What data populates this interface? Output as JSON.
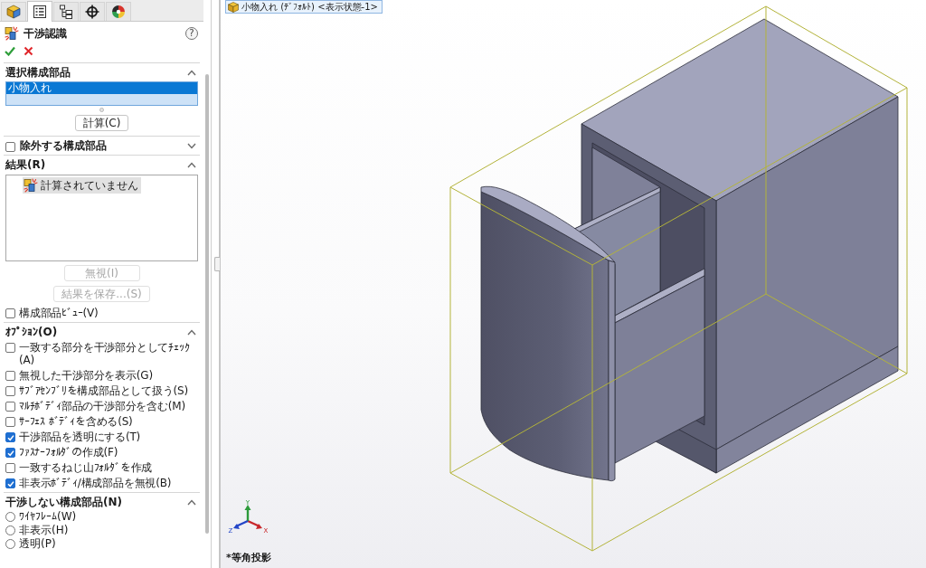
{
  "panel_tabs": [
    {
      "kind": "feature_tree",
      "selected": false
    },
    {
      "kind": "property_manager",
      "selected": true
    },
    {
      "kind": "configuration",
      "selected": false
    },
    {
      "kind": "dimxpert",
      "selected": false
    },
    {
      "kind": "display",
      "selected": false
    }
  ],
  "title": "干渉認識",
  "help": "?",
  "selected_components": {
    "heading": "選択構成部品",
    "expanded": true,
    "items": [
      {
        "label": "小物入れ",
        "selected": true
      }
    ],
    "calculate_button": "計算(C)"
  },
  "excluded_components": {
    "heading": "除外する構成部品",
    "checked": false,
    "expanded": false
  },
  "results": {
    "heading": "結果(R)",
    "expanded": true,
    "items": [
      {
        "label": "計算されていません",
        "selected": true
      }
    ],
    "buttons": [
      {
        "label": "無視(I)",
        "disabled": true
      },
      {
        "label": "結果を保存...(S)",
        "disabled": true
      }
    ],
    "component_view": {
      "label": "構成部品ﾋﾞｭｰ(V)",
      "checked": false
    }
  },
  "options": {
    "heading": "ｵﾌﾟｼｮﾝ(O)",
    "expanded": true,
    "items": [
      {
        "label": "一致する部分を干渉部分としてﾁｪｯｸ(A)",
        "checked": false
      },
      {
        "label": "無視した干渉部分を表示(G)",
        "checked": false
      },
      {
        "label": "ｻﾌﾞｱｾﾝﾌﾞﾘを構成部品として扱う(S)",
        "checked": false
      },
      {
        "label": "ﾏﾙﾁﾎﾞﾃﾞｨ部品の干渉部分を含む(M)",
        "checked": false
      },
      {
        "label": "ｻｰﾌｪｽ ﾎﾞﾃﾞｨを含める(S)",
        "checked": false
      },
      {
        "label": "干渉部品を透明にする(T)",
        "checked": true
      },
      {
        "label": "ﾌｧｽﾅｰﾌｫﾙﾀﾞの作成(F)",
        "checked": true
      },
      {
        "label": "一致するねじ山ﾌｫﾙﾀﾞを作成",
        "checked": false
      },
      {
        "label": "非表示ﾎﾞﾃﾞｨ/構成部品を無視(B)",
        "checked": true
      }
    ]
  },
  "non_interfering": {
    "heading": "干渉しない構成部品(N)",
    "expanded": true,
    "choices": [
      {
        "label": "ﾜｲﾔﾌﾚｰﾑ(W)",
        "selected": false
      },
      {
        "label": "非表示(H)",
        "selected": false
      },
      {
        "label": "透明(P)",
        "selected": false
      }
    ]
  },
  "viewport": {
    "tree_item": "小物入れ (ﾃﾞﾌｫﾙﾄ) <表示状態-1>",
    "axes": [
      {
        "kind": "x",
        "label": "X"
      },
      {
        "kind": "y",
        "label": "Y"
      },
      {
        "kind": "z",
        "label": "Z"
      }
    ],
    "view_name": "*等角投影"
  }
}
